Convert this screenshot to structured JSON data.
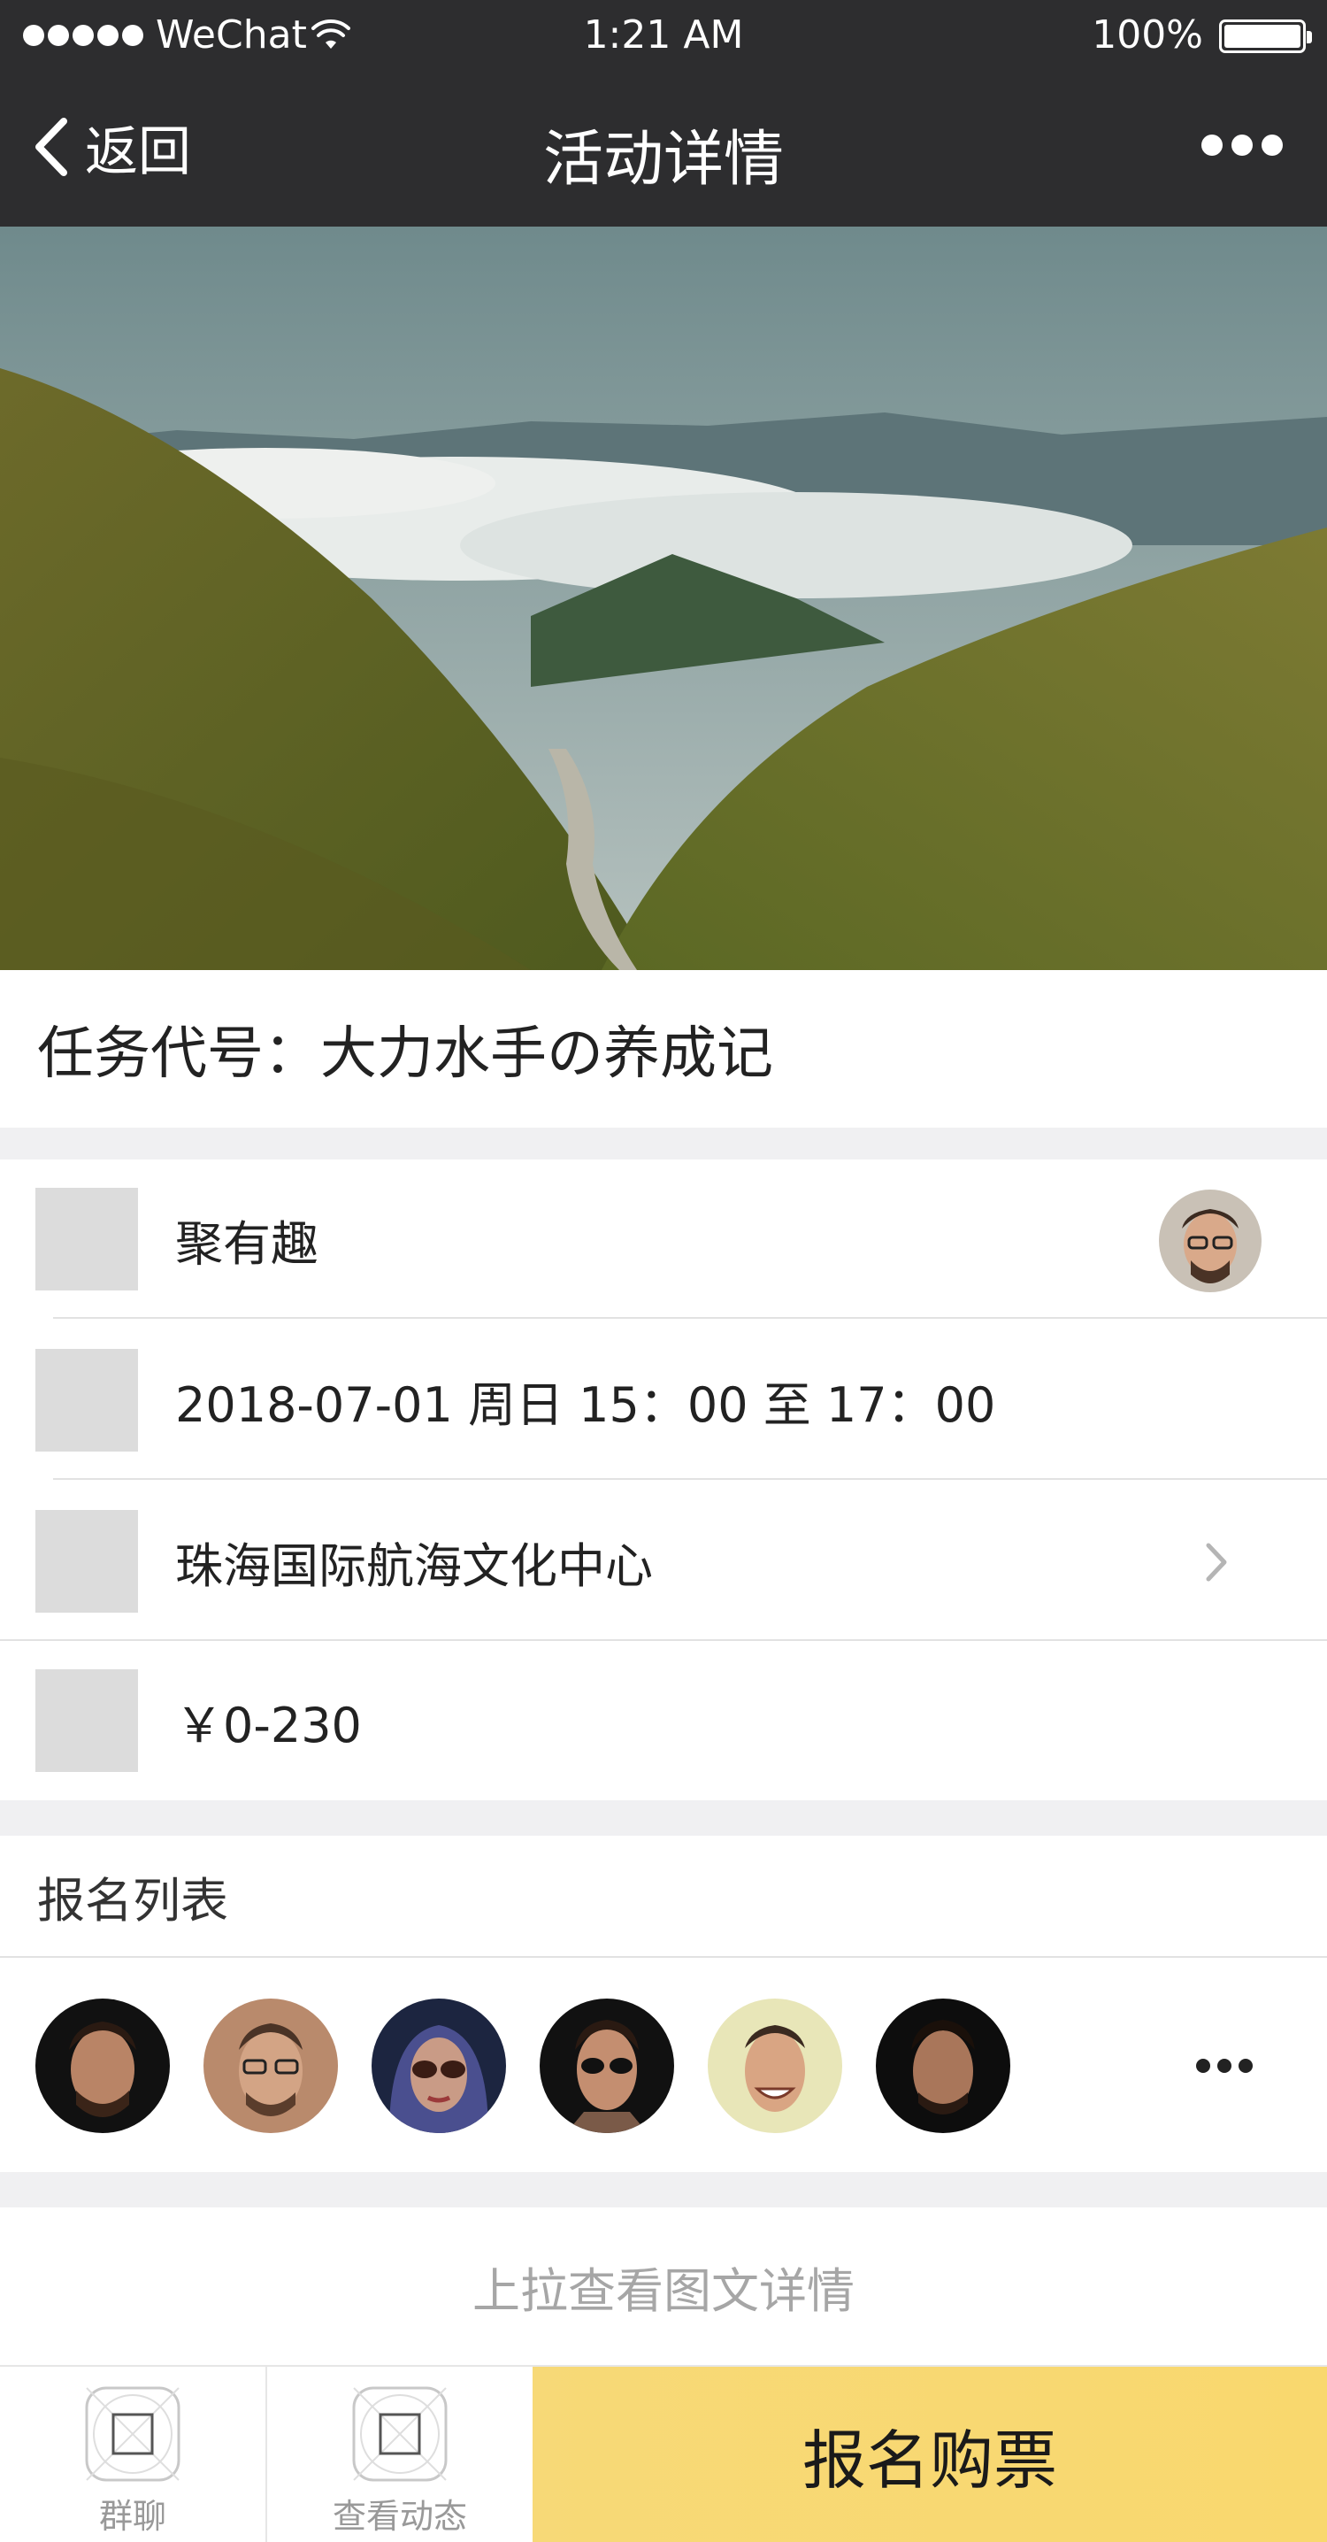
{
  "status_bar": {
    "carrier": "WeChat",
    "time": "1:21 AM",
    "battery": "100%"
  },
  "nav": {
    "back_label": "返回",
    "title": "活动详情"
  },
  "event": {
    "title": "任务代号：大力水手の养成记"
  },
  "info": {
    "organizer": "聚有趣",
    "datetime": "2018-07-01 周日 15：00 至 17：00",
    "location": "珠海国际航海文化中心",
    "price": "￥0-230"
  },
  "signup": {
    "heading": "报名列表"
  },
  "pull_hint": "上拉查看图文详情",
  "bottom_bar": {
    "group_chat": "群聊",
    "view_updates": "查看动态",
    "buy_ticket": "报名购票"
  },
  "colors": {
    "nav_bg": "#2d2d2f",
    "accent_yellow": "#f8d870",
    "placeholder_gray": "#dcdcdc"
  },
  "icons": [
    "wifi-icon",
    "battery-icon",
    "back-chevron-icon",
    "more-icon",
    "chevron-right-icon",
    "placeholder-tab-icon"
  ]
}
